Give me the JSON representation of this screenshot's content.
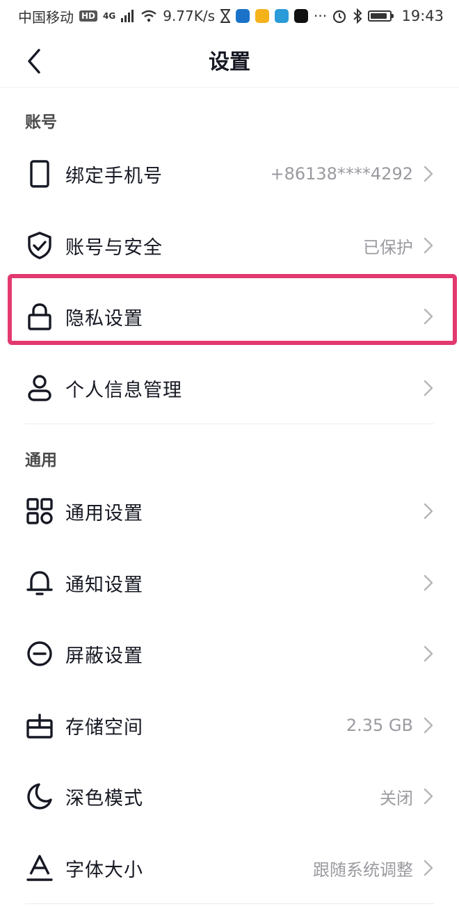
{
  "status_bar": {
    "carrier": "中国移动",
    "hd": "HD",
    "network": "4G",
    "speed": "9.77K/s",
    "more": "···",
    "time": "19:43"
  },
  "header": {
    "title": "设置",
    "back_icon": "chevron-left-icon"
  },
  "sections": {
    "account": {
      "title": "账号",
      "items": [
        {
          "label": "绑定手机号",
          "value": "+86138****4292",
          "icon": "phone-icon"
        },
        {
          "label": "账号与安全",
          "value": "已保护",
          "icon": "shield-check-icon"
        },
        {
          "label": "隐私设置",
          "value": "",
          "icon": "lock-icon"
        },
        {
          "label": "个人信息管理",
          "value": "",
          "icon": "person-icon"
        }
      ]
    },
    "general": {
      "title": "通用",
      "items": [
        {
          "label": "通用设置",
          "value": "",
          "icon": "grid-icon"
        },
        {
          "label": "通知设置",
          "value": "",
          "icon": "bell-icon"
        },
        {
          "label": "屏蔽设置",
          "value": "",
          "icon": "block-icon"
        },
        {
          "label": "存储空间",
          "value": "2.35 GB",
          "icon": "storage-icon"
        },
        {
          "label": "深色模式",
          "value": "关闭",
          "icon": "moon-icon"
        },
        {
          "label": "字体大小",
          "value": "跟随系统调整",
          "icon": "font-icon"
        }
      ]
    }
  },
  "colors": {
    "highlight": "#e2396f",
    "text_primary": "#161823",
    "text_secondary": "#9a9aa0"
  }
}
